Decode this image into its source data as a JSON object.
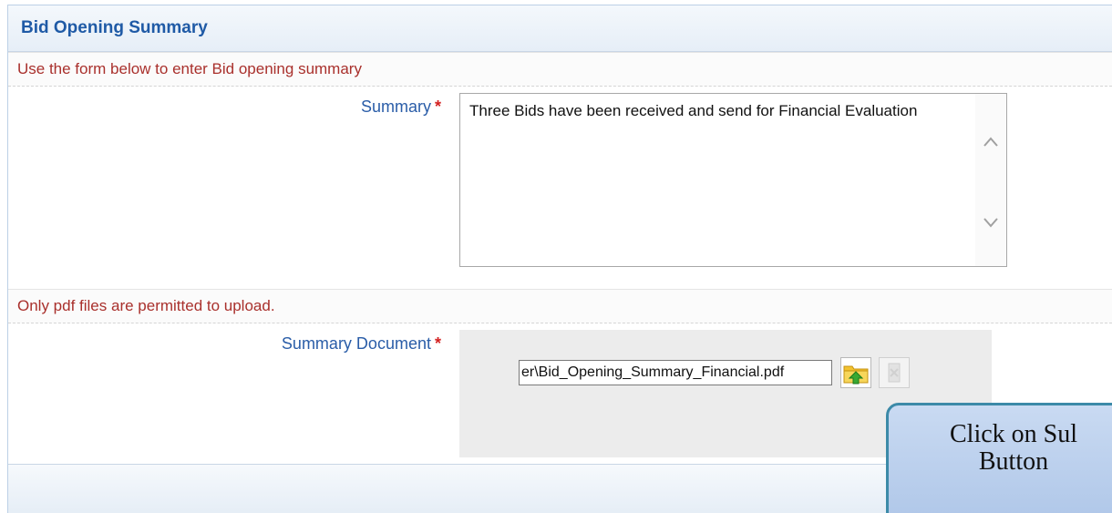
{
  "panel": {
    "title": "Bid Opening Summary"
  },
  "instructions": {
    "form_hint": "Use the form below to enter Bid opening summary",
    "upload_hint": "Only pdf files are permitted to upload."
  },
  "summary": {
    "label": "Summary",
    "required_mark": "*",
    "value": "Three Bids have been received and send for Financial Evaluation"
  },
  "summary_document": {
    "label": "Summary Document",
    "required_mark": "*",
    "file_path": "er\\Bid_Opening_Summary_Financial.pdf",
    "upload_icon": "folder-upload-icon",
    "clear_icon": "clear-file-icon"
  },
  "callout": {
    "line1": "Click on Sul",
    "line2": "Button"
  },
  "icons": {
    "scroll_up": "chevron-up-icon",
    "scroll_down": "chevron-down-icon"
  }
}
